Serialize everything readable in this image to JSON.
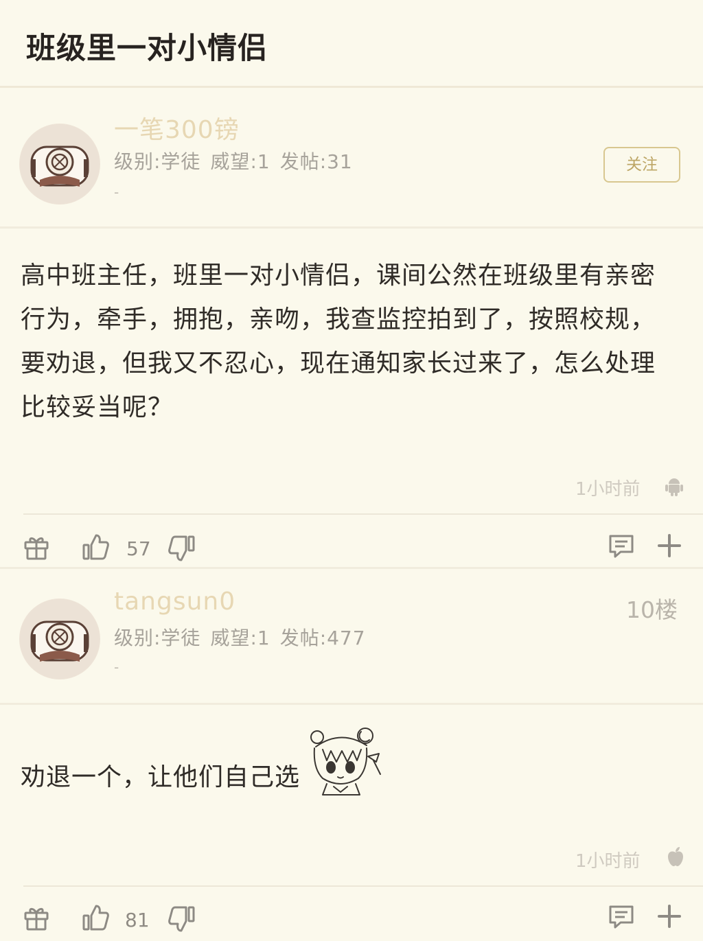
{
  "header": {
    "title": "班级里一对小情侣"
  },
  "post": {
    "author": {
      "name": "一笔300镑",
      "level_label": "级别:学徒",
      "prestige_label": "威望:1",
      "posts_label": "发帖:31",
      "signature": "-"
    },
    "follow_label": "关注",
    "content": "高中班主任，班里一对小情侣，课间公然在班级里有亲密行为，牵手，拥抱，亲吻，我查监控拍到了，按照校规，要劝退，但我又不忍心，现在通知家长过来了，怎么处理比较妥当呢？",
    "time": "1小时前",
    "platform_icon": "android-icon",
    "likes": "57"
  },
  "reply": {
    "author": {
      "name": "tangsun0",
      "level_label": "级别:学徒",
      "prestige_label": "威望:1",
      "posts_label": "发帖:477",
      "signature": "-"
    },
    "floor": "10楼",
    "content": "劝退一个，让他们自己选",
    "time": "1小时前",
    "platform_icon": "apple-icon",
    "likes": "81"
  },
  "icons": {
    "gift": "gift-icon",
    "like": "thumbs-up-icon",
    "dislike": "thumbs-down-icon",
    "comment": "comment-icon",
    "more": "plus-icon"
  },
  "colors": {
    "background": "#fbf9ec",
    "username": "#e7d7b3",
    "follow_border": "#d8c78f",
    "meta_text": "#a6a29a"
  }
}
